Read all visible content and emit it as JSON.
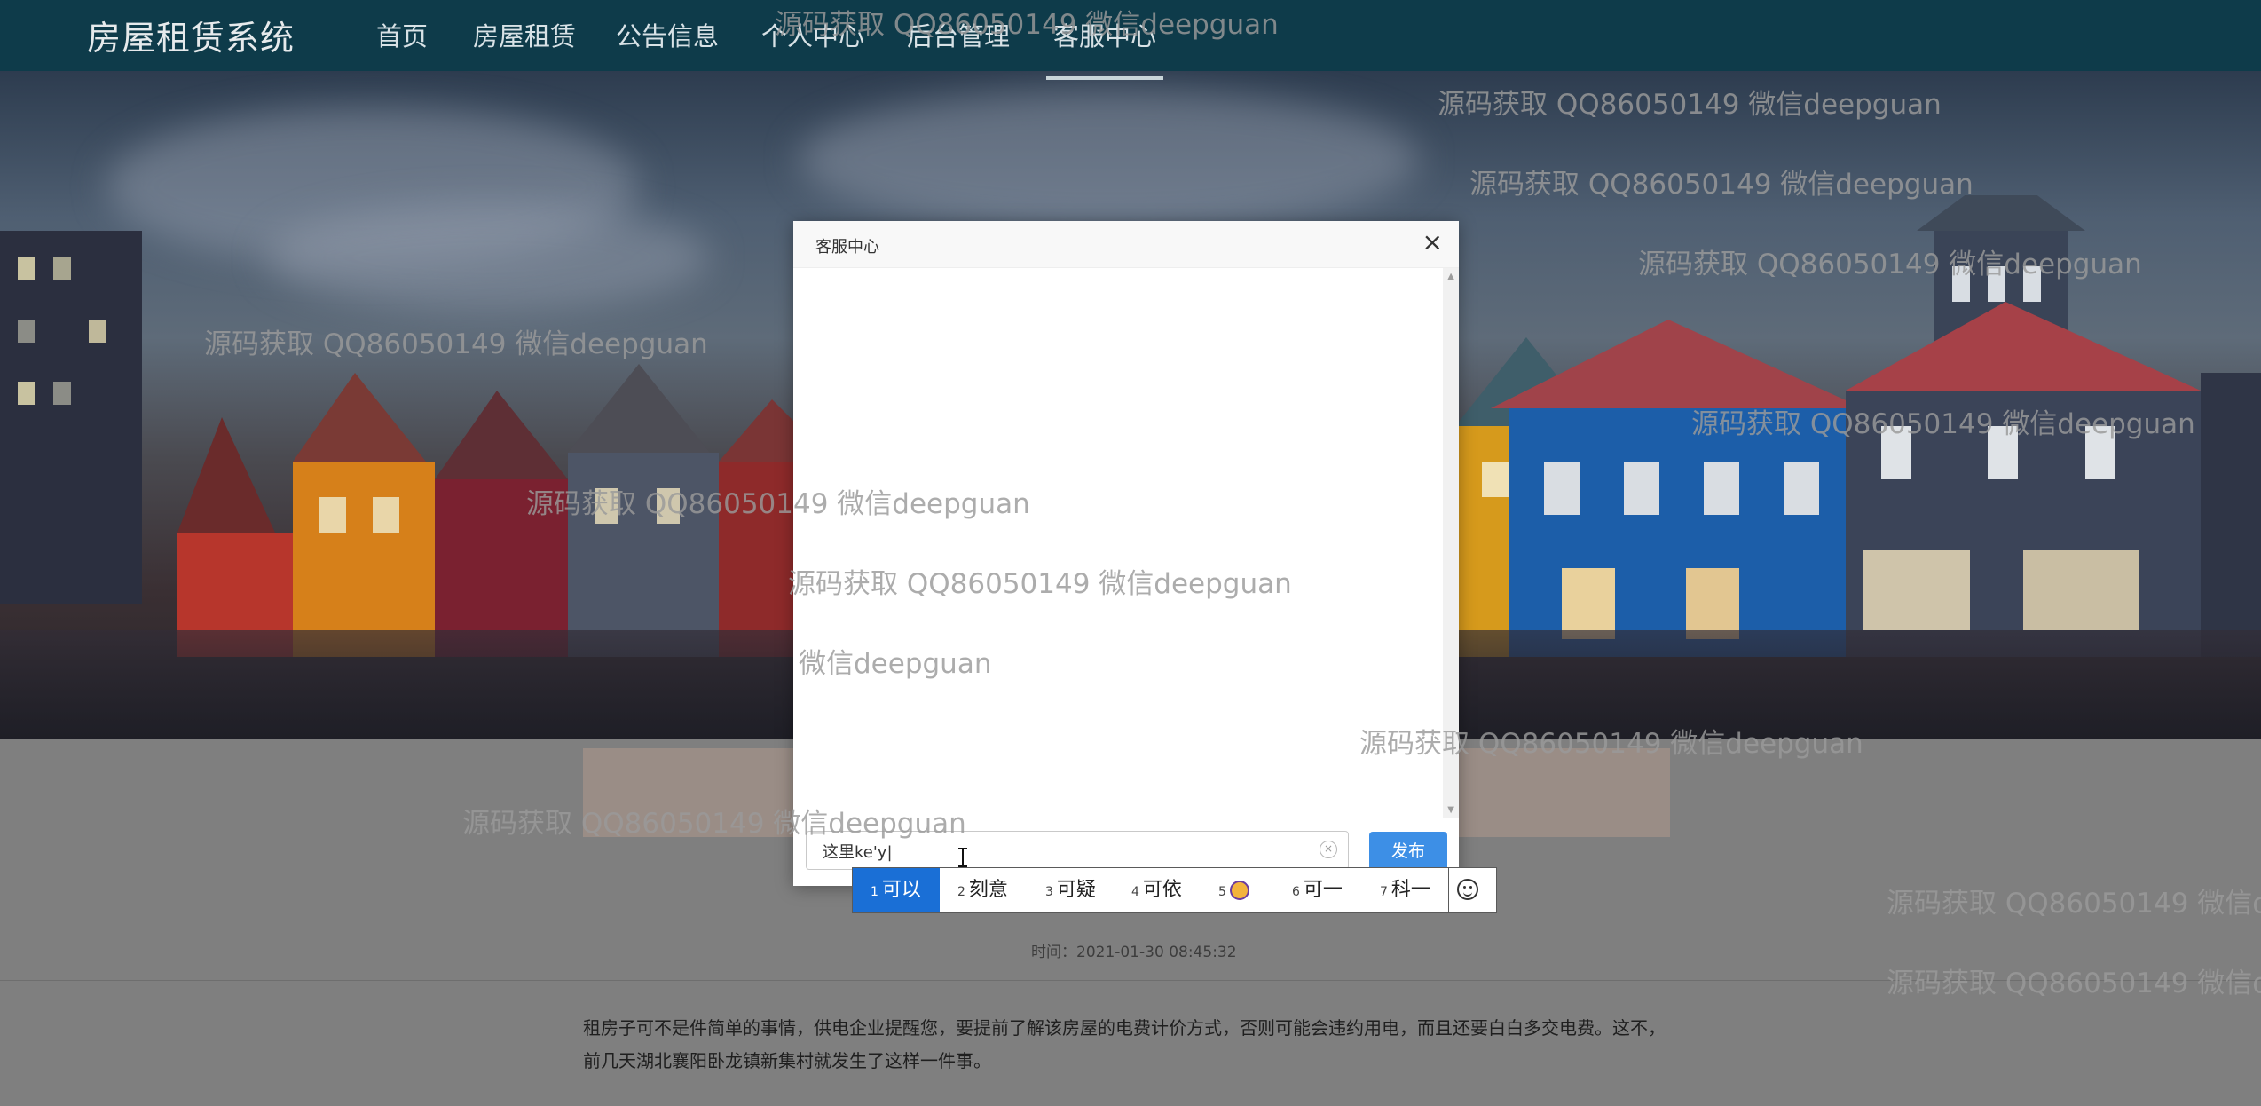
{
  "nav": {
    "brand": "房屋租赁系统",
    "items": [
      {
        "label": "首页"
      },
      {
        "label": "房屋租赁"
      },
      {
        "label": "公告信息"
      },
      {
        "label": "个人中心"
      },
      {
        "label": "后台管理"
      },
      {
        "label": "客服中心",
        "active": true
      }
    ]
  },
  "modal": {
    "title": "客服中心",
    "close_glyph": "×",
    "input_value": "这里ke'y|",
    "publish_label": "发布",
    "clear_glyph": "×"
  },
  "ime": {
    "candidates": [
      {
        "num": "1",
        "text": "可以",
        "selected": true
      },
      {
        "num": "2",
        "text": "刻意"
      },
      {
        "num": "3",
        "text": "可疑"
      },
      {
        "num": "4",
        "text": "可依"
      },
      {
        "num": "5",
        "text": "",
        "icon": "badge-icon"
      },
      {
        "num": "6",
        "text": "可一"
      },
      {
        "num": "7",
        "text": "科一"
      }
    ],
    "emoji_icon": "smiley-icon"
  },
  "page": {
    "time_label": "时间：2021-01-30 08:45:32",
    "article": "租房子可不是件简单的事情，供电企业提醒您，要提前了解该房屋的电费计价方式，否则可能会违约用电，而且还要白白多交电费。这不，前几天湖北襄阳卧龙镇新集村就发生了这样一件事。"
  },
  "watermark": {
    "text": "源码获取 QQ86050149 微信deepguan",
    "partial_text": "微信deepguan",
    "clipped_text": "源码获取 QQ86050149 微信de"
  },
  "colors": {
    "nav_bg": "#0e3b4a",
    "accent": "#3d8fe6",
    "ime_selected": "#1a6fd6",
    "overlay": "#7f7f7f"
  }
}
